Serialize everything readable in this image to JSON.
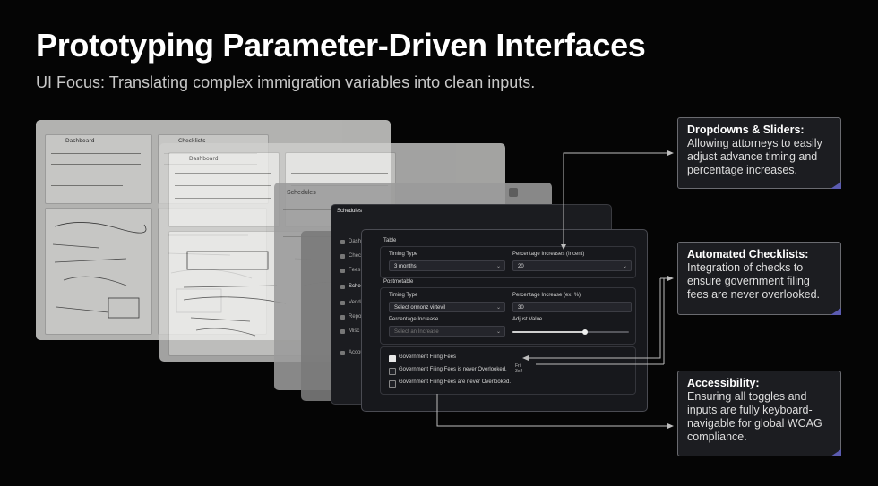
{
  "title": "Prototyping Parameter-Driven Interfaces",
  "subtitle": "UI Focus: Translating complex immigration variables into clean inputs.",
  "mockup": {
    "sketch_labels": [
      "Dashboard",
      "Checklists",
      "Dashboard",
      "Schedules"
    ],
    "schedules_header": "Schedules",
    "front_header": "Schedules",
    "nav": [
      "Dashb",
      "Checkl",
      "Fees",
      "Schedu",
      "Vendo",
      "Report",
      "Misc",
      "Accou"
    ],
    "table_section": "Table",
    "timing_type_label": "Timing Type",
    "timing_type_value": "3 months",
    "percentage_increases_label": "Percentage Increases (Incent)",
    "percentage_increases_value": "20",
    "postmetable_section": "Postmetable",
    "timing_type2_label": "Timing Type",
    "timing_type2_value": "Select ormonz virtevil",
    "percentage_increase2_label": "Percentage Increase (ex. %)",
    "percentage_increase2_value": "30",
    "percentage_increase3_label": "Percentage Increase",
    "percentage_increase3_placeholder": "Select an Increase",
    "adjust_value_label": "Adjust Value",
    "adjust_value_level": 0.62,
    "checklist": [
      {
        "label": "Government Filing Fees",
        "checked": true
      },
      {
        "label": "Government Filing Fees is never Overlooked.",
        "checked": false
      },
      {
        "label": "Government Filing Fees are never Overlooked.",
        "checked": false
      }
    ],
    "side_note": "Fri 3e2"
  },
  "callouts": [
    {
      "heading": "Dropdowns & Sliders:",
      "body": "Allowing attorneys to easily adjust advance timing and percentage increases."
    },
    {
      "heading": "Automated Checklists:",
      "body": "Integration of checks to ensure government filing fees are never overlooked."
    },
    {
      "heading": "Accessibility:",
      "body": "Ensuring all toggles and inputs are fully keyboard-navigable for global WCAG compliance."
    }
  ],
  "colors": {
    "background": "#050505",
    "accent": "#5b5bb0",
    "callout_bg": "#1c1d21"
  }
}
